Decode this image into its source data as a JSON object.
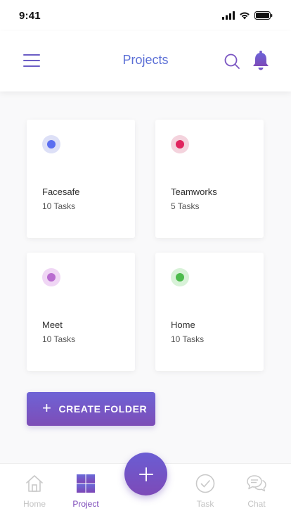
{
  "status_bar": {
    "time": "9:41"
  },
  "header": {
    "title": "Projects"
  },
  "projects": [
    {
      "name": "Facesafe",
      "count": "10 Tasks",
      "color": "#5b6ff0",
      "ring": "#dde0f7"
    },
    {
      "name": "Teamworks",
      "count": "5 Tasks",
      "color": "#e0245e",
      "ring": "#f4d3dd"
    },
    {
      "name": "Meet",
      "count": "10 Tasks",
      "color": "#b96bd0",
      "ring": "#f0d6f5"
    },
    {
      "name": "Home",
      "count": "10 Tasks",
      "color": "#4cbb4c",
      "ring": "#d8f2d8"
    }
  ],
  "create_button": {
    "label": "CREATE FOLDER"
  },
  "bottom_nav": {
    "items": [
      {
        "label": "Home",
        "icon": "home-icon"
      },
      {
        "label": "Project",
        "icon": "project-grid-icon"
      },
      {
        "label": "Task",
        "icon": "check-circle-icon"
      },
      {
        "label": "Chat",
        "icon": "chat-icon"
      }
    ],
    "active": "Project"
  },
  "colors": {
    "accent": "#6b5dc5",
    "title": "#5b6fd6",
    "active_nav": "#7a46b8"
  }
}
